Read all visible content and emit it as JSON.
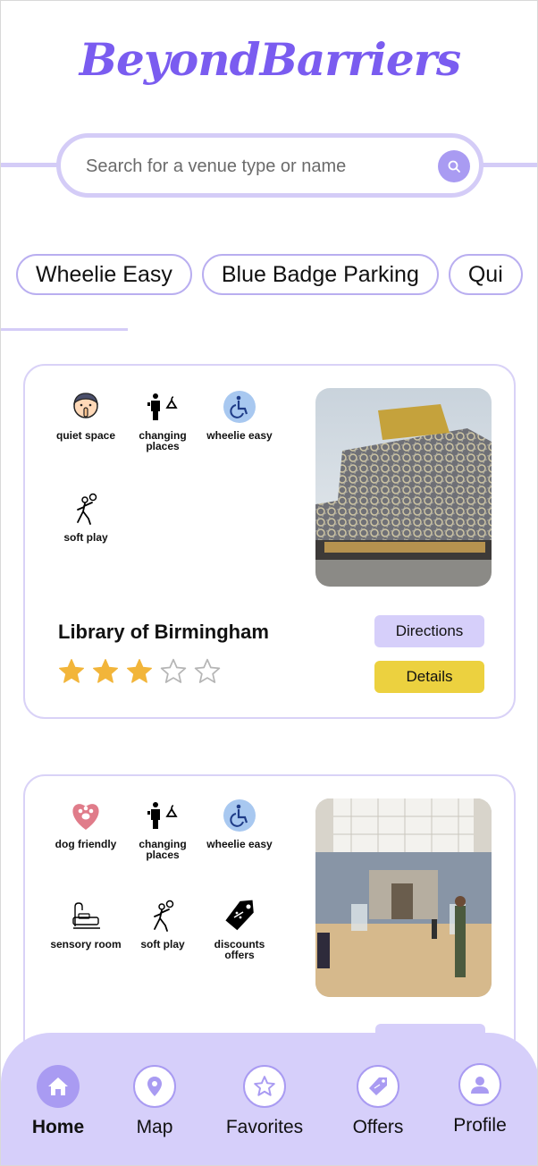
{
  "app": {
    "logo": "BeyondBarriers"
  },
  "colors": {
    "accent": "#7a5cf0",
    "accent_light": "#d6cffa",
    "details_button": "#ecd13f",
    "star": "#f2b53a"
  },
  "search": {
    "placeholder": "Search for a venue type or name",
    "icon": "search-icon"
  },
  "filters": [
    "Wheelie Easy",
    "Blue Badge Parking",
    "Qui"
  ],
  "venues": [
    {
      "name": "Library of Birmingham",
      "rating": 3,
      "max_rating": 5,
      "features": [
        {
          "icon": "quiet-space-icon",
          "label": "quiet space"
        },
        {
          "icon": "changing-places-icon",
          "label": "changing places"
        },
        {
          "icon": "wheelchair-icon",
          "label": "wheelie easy"
        },
        {
          "icon": "soft-play-icon",
          "label": "soft play"
        }
      ],
      "directions_label": "Directions",
      "details_label": "Details"
    },
    {
      "name": "",
      "features": [
        {
          "icon": "paw-icon",
          "label": "dog friendly"
        },
        {
          "icon": "changing-places-icon",
          "label": "changing places"
        },
        {
          "icon": "wheelchair-icon",
          "label": "wheelie easy"
        },
        {
          "icon": "sensory-room-icon",
          "label": "sensory room"
        },
        {
          "icon": "soft-play-icon",
          "label": "soft play"
        },
        {
          "icon": "discount-tag-icon",
          "label": "discounts offers"
        }
      ]
    }
  ],
  "nav": [
    {
      "label": "Home",
      "icon": "home-icon",
      "active": true
    },
    {
      "label": "Map",
      "icon": "map-pin-icon",
      "active": false
    },
    {
      "label": "Favorites",
      "icon": "star-icon",
      "active": false
    },
    {
      "label": "Offers",
      "icon": "tag-icon",
      "active": false
    },
    {
      "label": "Profile",
      "icon": "user-icon",
      "active": false
    }
  ]
}
